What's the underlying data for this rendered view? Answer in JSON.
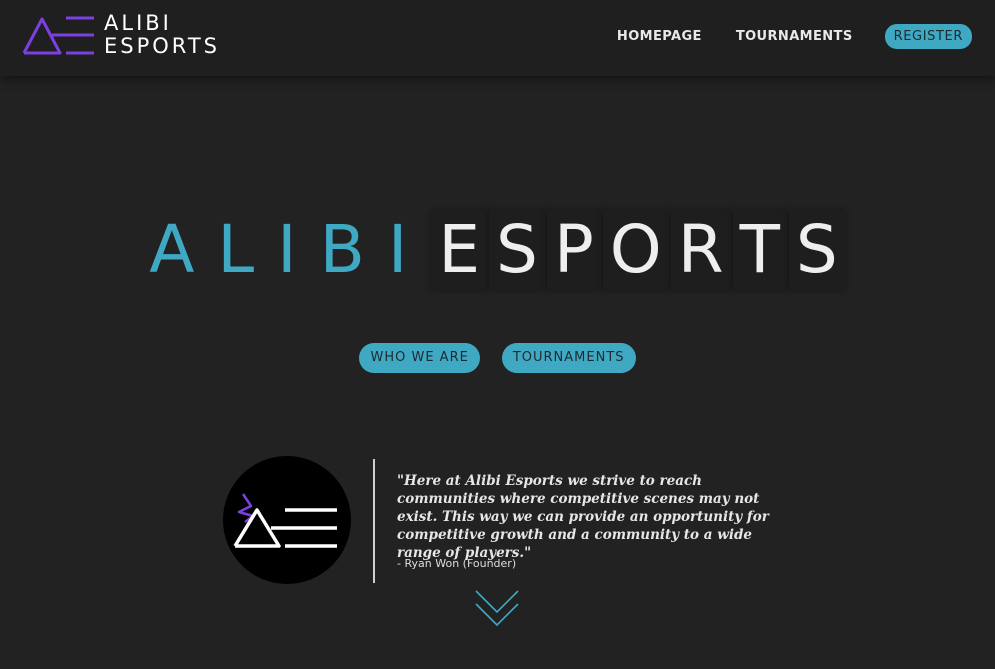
{
  "brand": {
    "line1": "ALIBI",
    "line2": "ESPORTS",
    "logo_icon": "alibi-ae-logo-icon",
    "accent_color": "#3fa9c4",
    "logo_purple": "#7b3fe4"
  },
  "nav": {
    "homepage": "HOMEPAGE",
    "tournaments": "TOURNAMENTS",
    "register": "REGISTER"
  },
  "hero": {
    "title_part1": "ALIBI",
    "title_part2_letters": [
      "E",
      "S",
      "P",
      "O",
      "R",
      "T",
      "S"
    ],
    "cta_who": "WHO WE ARE",
    "cta_tournaments": "TOURNAMENTS"
  },
  "founder": {
    "avatar_icon": "alibi-ae-avatar-icon",
    "quote": "\"Here at Alibi Esports we strive to reach communities where competitive scenes may not exist. This way we can provide an opportunity for competitive growth and a community to a wide range of players.\"",
    "attribution": "- Ryan Won (Founder)"
  },
  "scroll_icon": "double-chevron-down-icon"
}
